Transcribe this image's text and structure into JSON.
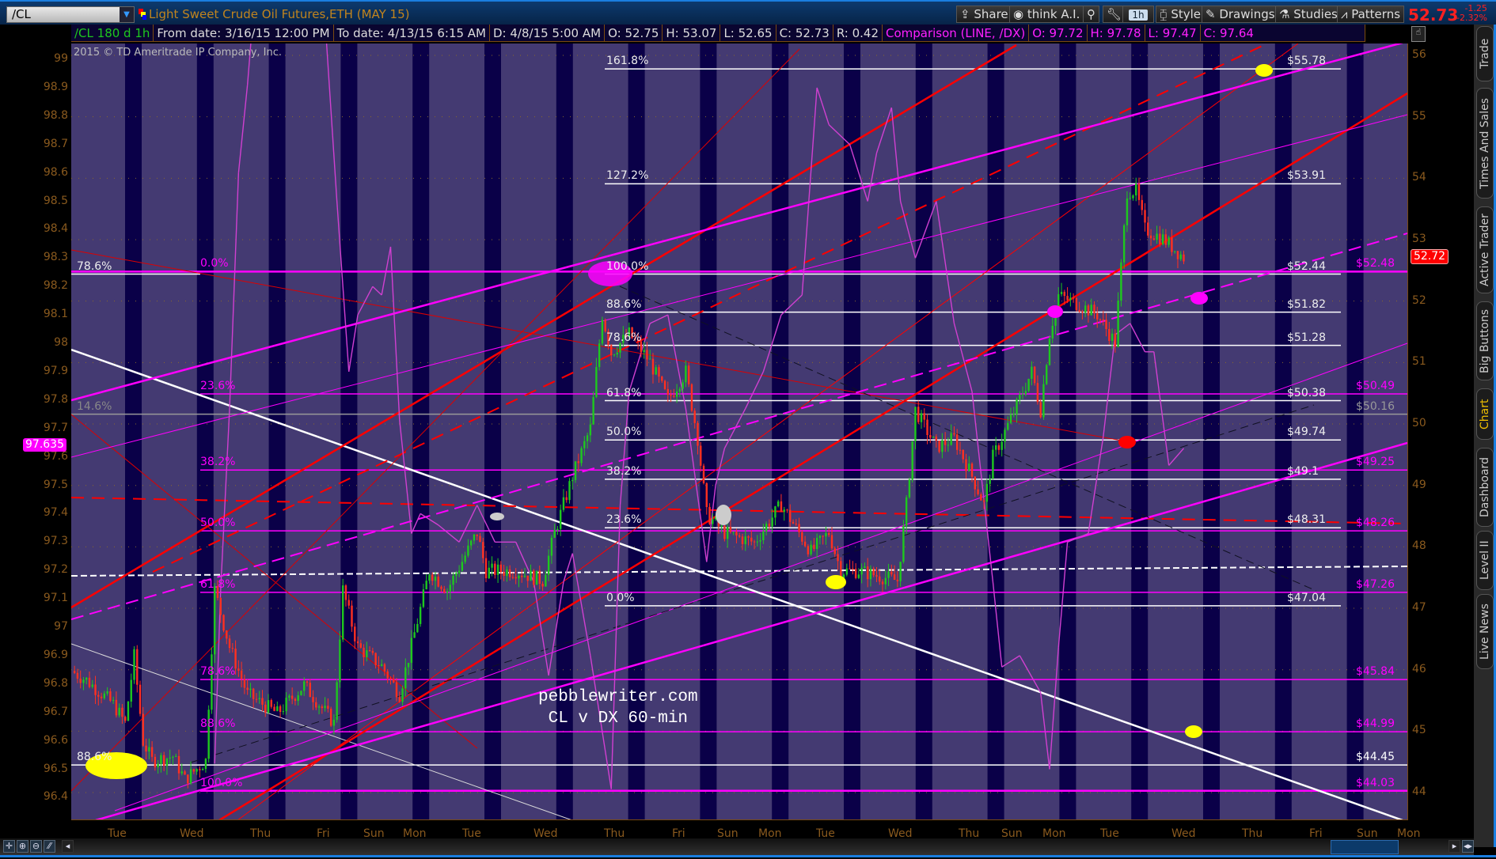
{
  "header": {
    "symbol": "/CL",
    "title": "Light Sweet Crude Oil Futures,ETH (MAY 15)",
    "toolbar": {
      "share": "Share",
      "think_ai": "think A.I.",
      "interval": "1h",
      "style": "Style",
      "drawings": "Drawings",
      "studies": "Studies",
      "patterns": "Patterns"
    },
    "last_price": "52.73",
    "change": "-1.25",
    "change_pct": "-2.32%"
  },
  "info_bar": {
    "symbol_period": "/CL 180 d 1h",
    "from_date": "From date: 3/16/15 12:00 PM",
    "to_date": "To date: 4/13/15 6:15 AM",
    "d": "D: 4/8/15 5:00 AM",
    "o": "O: 52.75",
    "h": "H: 53.07",
    "l": "L: 52.65",
    "c": "C: 52.73",
    "r": "R: 0.42",
    "comparison": "Comparison (LINE, /DX)",
    "cmp_o": "O: 97.72",
    "cmp_h": "H: 97.78",
    "cmp_l": "L: 97.47",
    "cmp_c": "C: 97.64"
  },
  "copyright": "2015 © TD Ameritrade IP Company, Inc.",
  "watermark": {
    "line1": "pebblewriter.com",
    "line2": "CL v DX 60-min"
  },
  "side_tabs": [
    "Trade",
    "Times And Sales",
    "Active Trader",
    "Big Buttons",
    "Chart",
    "Dashboard",
    "Level II",
    "Live News"
  ],
  "active_side_tab": "Chart",
  "colors": {
    "bg": "#443a72",
    "night": "#0a0048",
    "up": "#1ec81e",
    "down": "#ff3020",
    "dx": "#d040d0",
    "magenta": "#ff00ff",
    "axis": "#8a5a1e"
  },
  "chart_data": {
    "type": "candlestick+line",
    "right_axis": {
      "label": "/CL",
      "range": [
        43.6,
        56.2
      ],
      "ticks": [
        44,
        45,
        46,
        47,
        48,
        49,
        50,
        51,
        52,
        53,
        54,
        55,
        56
      ]
    },
    "left_axis": {
      "label": "/DX",
      "range": [
        96.33,
        99.06
      ],
      "ticks": [
        "96.4",
        "96.5",
        "96.6",
        "96.7",
        "96.8",
        "96.9",
        "97",
        "97.1",
        "97.2",
        "97.3",
        "97.4",
        "97.5",
        "97.6",
        "97.7",
        "97.8",
        "97.9",
        "98",
        "98.1",
        "98.2",
        "98.3",
        "98.4",
        "98.5",
        "98.6",
        "98.7",
        "98.8",
        "98.9",
        "99"
      ]
    },
    "x_tick_labels": [
      "Tue",
      "Wed",
      "Thu",
      "Fri",
      "Sun",
      "Mon",
      "Tue",
      "Wed",
      "Thu",
      "Fri",
      "Sun",
      "Mon",
      "Tue",
      "Wed",
      "Thu",
      "Sun",
      "Mon",
      "Tue",
      "Wed",
      "Thu",
      "Fri",
      "Sun",
      "Mon"
    ],
    "cl_price_keypoints_hours_price": [
      [
        0,
        45.98
      ],
      [
        5,
        45.83
      ],
      [
        14,
        45.44
      ],
      [
        18,
        45.13
      ],
      [
        21,
        46.22
      ],
      [
        24,
        44.83
      ],
      [
        27,
        44.52
      ],
      [
        34,
        44.59
      ],
      [
        38,
        44.21
      ],
      [
        45,
        44.52
      ],
      [
        48,
        47.3
      ],
      [
        53,
        46.37
      ],
      [
        59,
        45.6
      ],
      [
        69,
        45.29
      ],
      [
        78,
        45.75
      ],
      [
        88,
        45.13
      ],
      [
        91,
        47.3
      ],
      [
        96,
        46.37
      ],
      [
        104,
        46.06
      ],
      [
        110,
        45.6
      ],
      [
        117,
        46.99
      ],
      [
        120,
        47.61
      ],
      [
        126,
        47.3
      ],
      [
        136,
        48.23
      ],
      [
        139,
        47.61
      ],
      [
        149,
        47.61
      ],
      [
        158,
        47.45
      ],
      [
        162,
        48.23
      ],
      [
        168,
        49.15
      ],
      [
        174,
        49.93
      ],
      [
        178,
        51.78
      ],
      [
        181,
        51.16
      ],
      [
        187,
        51.47
      ],
      [
        194,
        51.01
      ],
      [
        200,
        50.39
      ],
      [
        206,
        50.85
      ],
      [
        210,
        49.77
      ],
      [
        213,
        48.53
      ],
      [
        219,
        48.23
      ],
      [
        229,
        48.07
      ],
      [
        238,
        48.69
      ],
      [
        248,
        47.92
      ],
      [
        254,
        48.23
      ],
      [
        258,
        47.61
      ],
      [
        264,
        47.61
      ],
      [
        277,
        47.45
      ],
      [
        280,
        48.69
      ],
      [
        283,
        50.23
      ],
      [
        290,
        49.62
      ],
      [
        296,
        49.77
      ],
      [
        302,
        49.15
      ],
      [
        306,
        48.69
      ],
      [
        309,
        49.46
      ],
      [
        315,
        50.08
      ],
      [
        322,
        50.85
      ],
      [
        325,
        50.23
      ],
      [
        328,
        51.47
      ],
      [
        331,
        52.09
      ],
      [
        338,
        51.94
      ],
      [
        344,
        51.78
      ],
      [
        350,
        51.32
      ],
      [
        354,
        53.79
      ],
      [
        357,
        53.79
      ],
      [
        360,
        53.17
      ],
      [
        366,
        53.02
      ],
      [
        373,
        52.71
      ]
    ],
    "dx_keypoints_hours_price": [
      [
        48,
        96.52
      ],
      [
        50,
        97.13
      ],
      [
        53,
        97.77
      ],
      [
        56,
        98.6
      ],
      [
        59,
        98.91
      ],
      [
        62,
        99.3
      ],
      [
        84,
        99.3
      ],
      [
        89,
        98.5
      ],
      [
        93,
        97.9
      ],
      [
        96,
        98.1
      ],
      [
        101,
        98.2
      ],
      [
        104,
        98.17
      ],
      [
        107,
        98.34
      ],
      [
        110,
        97.73
      ],
      [
        114,
        97.33
      ],
      [
        117,
        97.4
      ],
      [
        123,
        97.36
      ],
      [
        130,
        97.3
      ],
      [
        136,
        97.43
      ],
      [
        142,
        97.3
      ],
      [
        149,
        97.3
      ],
      [
        155,
        97.16
      ],
      [
        160,
        96.83
      ],
      [
        165,
        97.16
      ],
      [
        168,
        97.26
      ],
      [
        174,
        96.9
      ],
      [
        181,
        96.43
      ],
      [
        184,
        97.43
      ],
      [
        187,
        97.83
      ],
      [
        194,
        98.07
      ],
      [
        200,
        98.1
      ],
      [
        206,
        97.77
      ],
      [
        213,
        97.23
      ],
      [
        216,
        97.5
      ],
      [
        219,
        97.63
      ],
      [
        226,
        97.77
      ],
      [
        232,
        97.9
      ],
      [
        238,
        98.1
      ],
      [
        245,
        98.17
      ],
      [
        250,
        98.9
      ],
      [
        254,
        98.77
      ],
      [
        261,
        98.7
      ],
      [
        267,
        98.5
      ],
      [
        270,
        98.67
      ],
      [
        275,
        98.83
      ],
      [
        278,
        98.5
      ],
      [
        283,
        98.3
      ],
      [
        290,
        98.5
      ],
      [
        296,
        98.07
      ],
      [
        302,
        97.83
      ],
      [
        309,
        97.16
      ],
      [
        312,
        96.86
      ],
      [
        318,
        96.9
      ],
      [
        325,
        96.77
      ],
      [
        328,
        96.5
      ],
      [
        331,
        96.93
      ],
      [
        334,
        97.3
      ],
      [
        341,
        97.33
      ],
      [
        346,
        97.67
      ],
      [
        350,
        98.03
      ],
      [
        355,
        98.07
      ],
      [
        360,
        97.97
      ],
      [
        363,
        97.97
      ],
      [
        368,
        97.57
      ],
      [
        373,
        97.63
      ]
    ],
    "fib_levels_white": [
      {
        "label": "161.8%",
        "price": 55.78,
        "price_label": "$55.78"
      },
      {
        "label": "127.2%",
        "price": 53.91,
        "price_label": "$53.91"
      },
      {
        "label": "100.0%",
        "price": 52.44,
        "price_label": "$52.44"
      },
      {
        "label": "88.6%",
        "price": 51.82,
        "price_label": "$51.82"
      },
      {
        "label": "78.6%",
        "price": 51.28,
        "price_label": "$51.28"
      },
      {
        "label": "61.8%",
        "price": 50.38,
        "price_label": "$50.38"
      },
      {
        "label": "50.0%",
        "price": 49.74,
        "price_label": "$49.74"
      },
      {
        "label": "38.2%",
        "price": 49.1,
        "price_label": "$49.1"
      },
      {
        "label": "23.6%",
        "price": 48.31,
        "price_label": "$48.31"
      },
      {
        "label": "0.0%",
        "price": 47.04,
        "price_label": "$47.04"
      }
    ],
    "fib_levels_magenta": [
      {
        "label": "0.0%",
        "price": 52.48,
        "price_label": "$52.48"
      },
      {
        "label": "23.6%",
        "price": 50.49,
        "price_label": "$50.49"
      },
      {
        "label": "38.2%",
        "price": 49.25,
        "price_label": "$49.25"
      },
      {
        "label": "50.0%",
        "price": 48.26,
        "price_label": "$48.26"
      },
      {
        "label": "61.8%",
        "price": 47.26,
        "price_label": "$47.26"
      },
      {
        "label": "78.6%",
        "price": 45.84,
        "price_label": "$45.84"
      },
      {
        "label": "88.6%",
        "price": 44.99,
        "price_label": "$44.99"
      },
      {
        "label": "100.0%",
        "price": 44.03,
        "price_label": "$44.03"
      }
    ],
    "fib_levels_left_white": [
      {
        "label": "78.6%",
        "price": 52.44,
        "price_label": ""
      },
      {
        "label": "14.6%",
        "price": 50.16,
        "price_label": "$50.16",
        "muted": true
      },
      {
        "label": "88.6%",
        "price": 44.45,
        "price_label": "$44.45"
      }
    ],
    "current_price_badge": "52.72",
    "dx_price_badge": "97.635"
  }
}
